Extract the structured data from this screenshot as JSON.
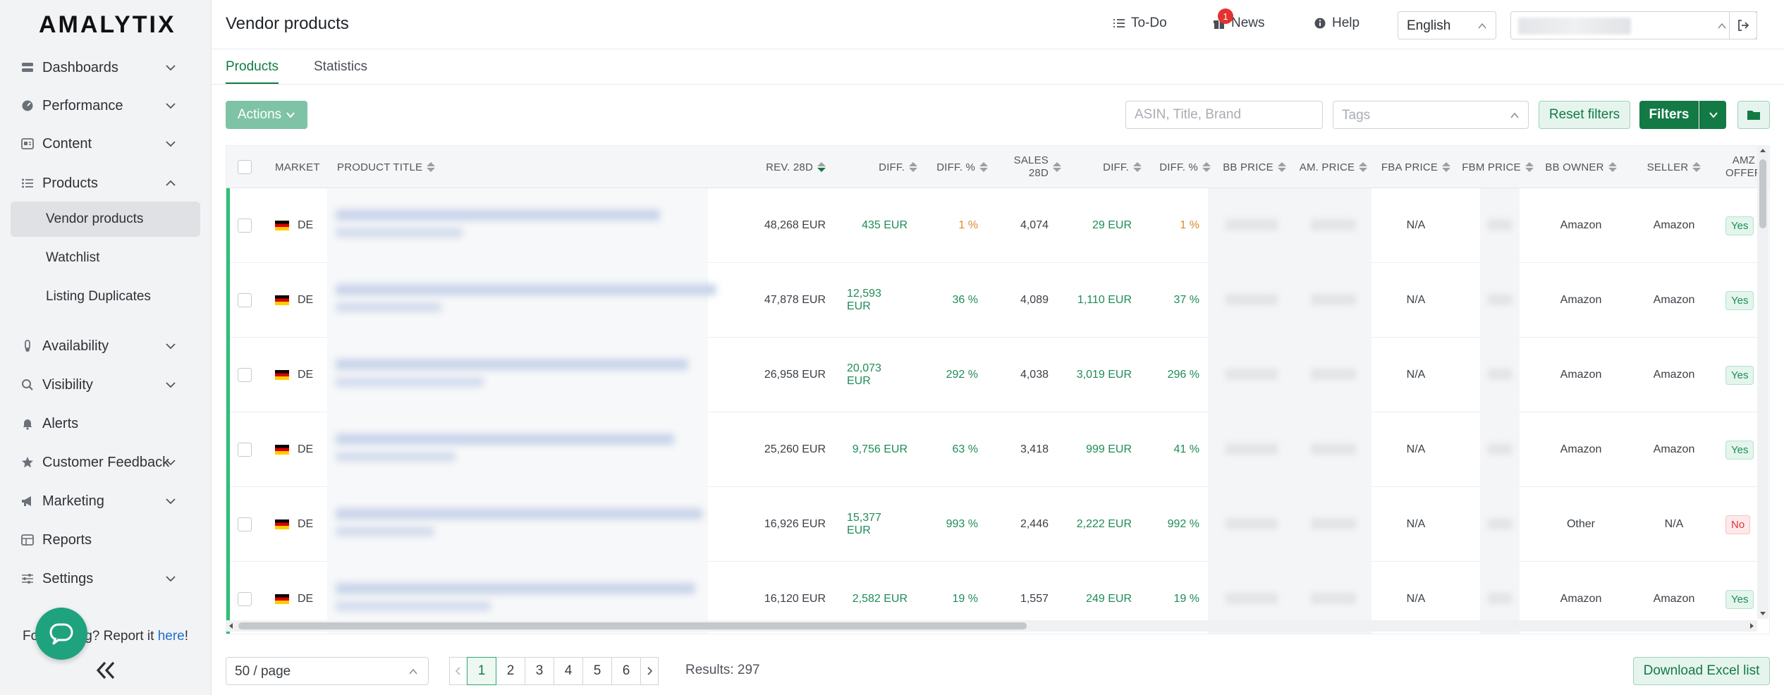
{
  "app": {
    "logo": "AMALYTIX"
  },
  "sidebar": {
    "items": [
      {
        "label": "Dashboards",
        "icon": "dashboard-icon"
      },
      {
        "label": "Performance",
        "icon": "performance-icon"
      },
      {
        "label": "Content",
        "icon": "content-icon"
      },
      {
        "label": "Products",
        "icon": "products-icon"
      },
      {
        "label": "Availability",
        "icon": "availability-icon"
      },
      {
        "label": "Visibility",
        "icon": "search-icon"
      },
      {
        "label": "Alerts",
        "icon": "bell-icon"
      },
      {
        "label": "Customer Feedback",
        "icon": "star-icon"
      },
      {
        "label": "Marketing",
        "icon": "megaphone-icon"
      },
      {
        "label": "Reports",
        "icon": "table-icon"
      },
      {
        "label": "Settings",
        "icon": "sliders-icon"
      }
    ],
    "products_sub": [
      "Vendor products",
      "Watchlist",
      "Listing Duplicates"
    ],
    "report_prefix": "Fo",
    "report_middle": "g? Report it ",
    "report_link": "here",
    "report_suffix": "!"
  },
  "header": {
    "title": "Vendor products",
    "todo": "To-Do",
    "news": "News",
    "news_badge": "1",
    "help": "Help",
    "language": "English"
  },
  "tabs": [
    "Products",
    "Statistics"
  ],
  "toolbar": {
    "actions": "Actions",
    "search_placeholder": "ASIN, Title, Brand",
    "tags_placeholder": "Tags",
    "reset_filters": "Reset filters",
    "filters": "Filters"
  },
  "table": {
    "headers": {
      "market": "Market",
      "product_title": "Product Title",
      "rev_28d": "Rev. 28D",
      "diff": "Diff.",
      "diff_pct": "Diff. %",
      "sales_28d_line1": "Sales",
      "sales_28d_line2": "28D",
      "diff2": "Diff.",
      "diff_pct2": "Diff. %",
      "bb_price": "BB Price",
      "am_price": "Am. Price",
      "fba_price": "FBA Price",
      "fbm_price": "FBM Price",
      "bb_owner": "BB Owner",
      "seller": "Seller",
      "amz_offer_line1": "AMZ",
      "amz_offer_line2": "Offer"
    },
    "rows": [
      {
        "market": "DE",
        "rev": "48,268 EUR",
        "diff": "435 EUR",
        "diff_pct": "1 %",
        "sales": "4,074",
        "diff2": "29 EUR",
        "diff_pct2": "1 %",
        "fba": "N/A",
        "bb_owner": "Amazon",
        "seller": "Amazon",
        "amz_offer": "Yes"
      },
      {
        "market": "DE",
        "rev": "47,878 EUR",
        "diff": "12,593 EUR",
        "diff_pct": "36 %",
        "sales": "4,089",
        "diff2": "1,110 EUR",
        "diff_pct2": "37 %",
        "fba": "N/A",
        "bb_owner": "Amazon",
        "seller": "Amazon",
        "amz_offer": "Yes"
      },
      {
        "market": "DE",
        "rev": "26,958 EUR",
        "diff": "20,073 EUR",
        "diff_pct": "292 %",
        "sales": "4,038",
        "diff2": "3,019 EUR",
        "diff_pct2": "296 %",
        "fba": "N/A",
        "bb_owner": "Amazon",
        "seller": "Amazon",
        "amz_offer": "Yes"
      },
      {
        "market": "DE",
        "rev": "25,260 EUR",
        "diff": "9,756 EUR",
        "diff_pct": "63 %",
        "sales": "3,418",
        "diff2": "999 EUR",
        "diff_pct2": "41 %",
        "fba": "N/A",
        "bb_owner": "Amazon",
        "seller": "Amazon",
        "amz_offer": "Yes"
      },
      {
        "market": "DE",
        "rev": "16,926 EUR",
        "diff": "15,377 EUR",
        "diff_pct": "993 %",
        "sales": "2,446",
        "diff2": "2,222 EUR",
        "diff_pct2": "992 %",
        "fba": "N/A",
        "bb_owner": "Other",
        "seller": "N/A",
        "amz_offer": "No"
      },
      {
        "market": "DE",
        "rev": "16,120 EUR",
        "diff": "2,582 EUR",
        "diff_pct": "19 %",
        "sales": "1,557",
        "diff2": "249 EUR",
        "diff_pct2": "19 %",
        "fba": "N/A",
        "bb_owner": "Amazon",
        "seller": "Amazon",
        "amz_offer": "Yes"
      }
    ]
  },
  "footer": {
    "page_size": "50 / page",
    "pages": [
      "1",
      "2",
      "3",
      "4",
      "5",
      "6"
    ],
    "current_page": "1",
    "results": "Results: 297",
    "download": "Download Excel list"
  },
  "colors": {
    "brand_green": "#137a45",
    "accent_green": "#2fbf78",
    "badge_red": "#e5312f",
    "diff_orange": "#e0892a"
  }
}
